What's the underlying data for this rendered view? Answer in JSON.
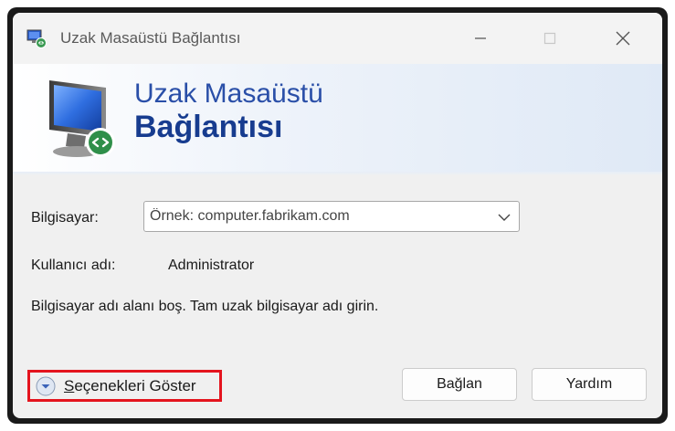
{
  "window": {
    "title": "Uzak Masaüstü Bağlantısı",
    "icon": "remote-desktop-icon",
    "controls": [
      "minimize-icon",
      "maximize-icon",
      "close-icon"
    ]
  },
  "banner": {
    "line1": "Uzak Masaüstü",
    "line2": "Bağlantısı",
    "icon": "monitor-remote-icon"
  },
  "form": {
    "computer_label": "Bilgisayar:",
    "computer_placeholder": "Örnek: computer.fabrikam.com",
    "computer_value": "",
    "username_label": "Kullanıcı adı:",
    "username_value": "Administrator",
    "message": "Bilgisayar adı alanı boş. Tam uzak bilgisayar adı girin."
  },
  "footer": {
    "options_accesskey": "S",
    "options_label_rest": "eçenekleri Göster",
    "connect_label": "Bağlan",
    "help_label": "Yardım"
  },
  "colors": {
    "highlight": "#e4141e",
    "banner_text": "#173c8f",
    "window_bg": "#f0f0f0"
  }
}
